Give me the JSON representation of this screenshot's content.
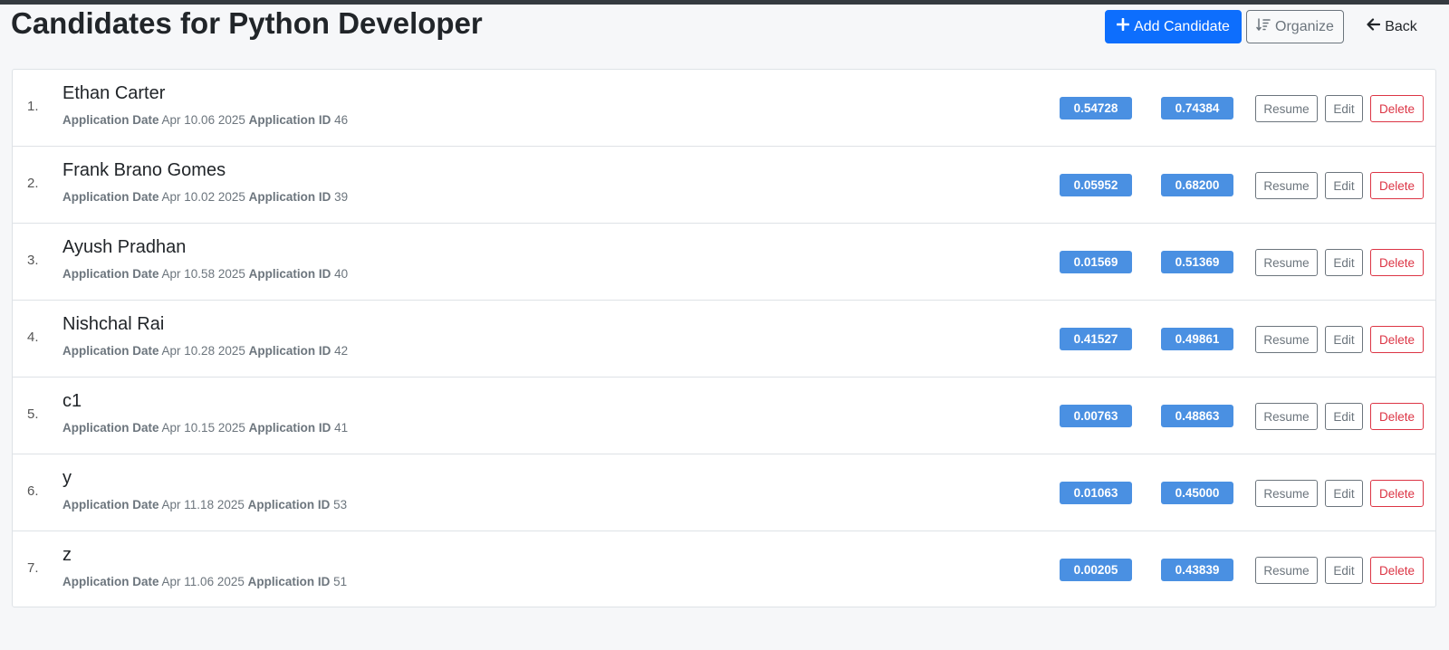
{
  "page": {
    "title": "Candidates for Python Developer"
  },
  "header": {
    "add_label": "Add Candidate",
    "add_icon": "plus-icon",
    "organize_label": "Organize",
    "organize_icon": "sort-icon",
    "back_label": "Back",
    "back_icon": "arrow-left-icon"
  },
  "labels": {
    "application_date": "Application Date",
    "application_id": "Application ID",
    "resume": "Resume",
    "edit": "Edit",
    "delete": "Delete"
  },
  "colors": {
    "primary": "#0d6efd",
    "score_badge": "#4a90e2",
    "danger": "#dc3545",
    "secondary": "#6c757d"
  },
  "candidates": [
    {
      "num": "1.",
      "name": "Ethan Carter",
      "date": "Apr 10.06 2025",
      "id": "46",
      "score1": "0.54728",
      "score2": "0.74384"
    },
    {
      "num": "2.",
      "name": "Frank Brano Gomes",
      "date": "Apr 10.02 2025",
      "id": "39",
      "score1": "0.05952",
      "score2": "0.68200"
    },
    {
      "num": "3.",
      "name": "Ayush Pradhan",
      "date": "Apr 10.58 2025",
      "id": "40",
      "score1": "0.01569",
      "score2": "0.51369"
    },
    {
      "num": "4.",
      "name": "Nishchal Rai",
      "date": "Apr 10.28 2025",
      "id": "42",
      "score1": "0.41527",
      "score2": "0.49861"
    },
    {
      "num": "5.",
      "name": "c1",
      "date": "Apr 10.15 2025",
      "id": "41",
      "score1": "0.00763",
      "score2": "0.48863"
    },
    {
      "num": "6.",
      "name": "y",
      "date": "Apr 11.18 2025",
      "id": "53",
      "score1": "0.01063",
      "score2": "0.45000"
    },
    {
      "num": "7.",
      "name": "z",
      "date": "Apr 11.06 2025",
      "id": "51",
      "score1": "0.00205",
      "score2": "0.43839"
    }
  ]
}
